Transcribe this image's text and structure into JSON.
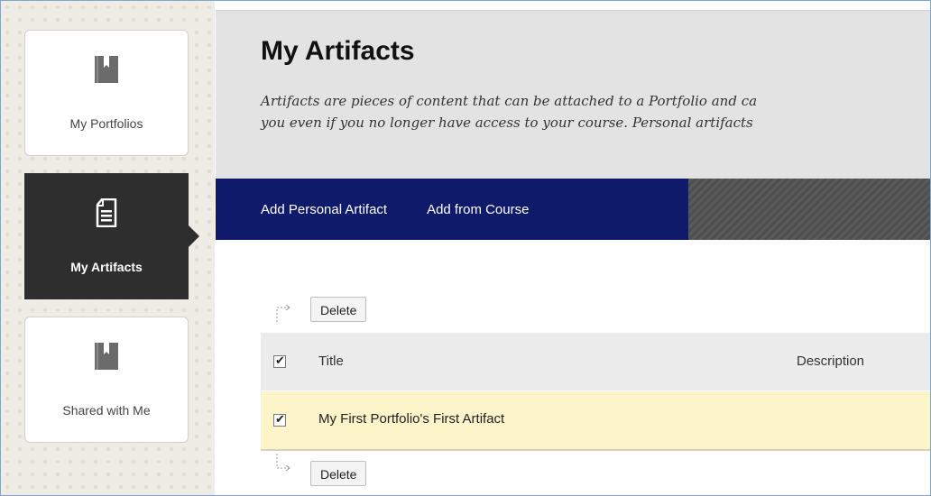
{
  "sidebar": {
    "items": [
      {
        "label": "My Portfolios",
        "icon": "bookmark-book-icon"
      },
      {
        "label": "My Artifacts",
        "icon": "document-icon",
        "active": true
      },
      {
        "label": "Shared with Me",
        "icon": "bookmark-book-icon"
      }
    ]
  },
  "header": {
    "title": "My Artifacts",
    "description_line1": "Artifacts are pieces of content that can be attached to a Portfolio and ca",
    "description_line2": "you even if you no longer have access to your course. Personal artifacts"
  },
  "nav": {
    "add_personal": "Add Personal Artifact",
    "add_course": "Add from Course"
  },
  "actions": {
    "delete_top": "Delete",
    "delete_bottom": "Delete"
  },
  "table": {
    "columns": [
      "Title",
      "Description"
    ],
    "rows": [
      {
        "title": "My First Portfolio's First Artifact",
        "description": "",
        "checked": true
      }
    ],
    "header_checked": true
  },
  "colors": {
    "nav_blue": "#0f1a6b",
    "active_sidebar": "#2e2e2e",
    "row_highlight": "#fdf4c9"
  }
}
